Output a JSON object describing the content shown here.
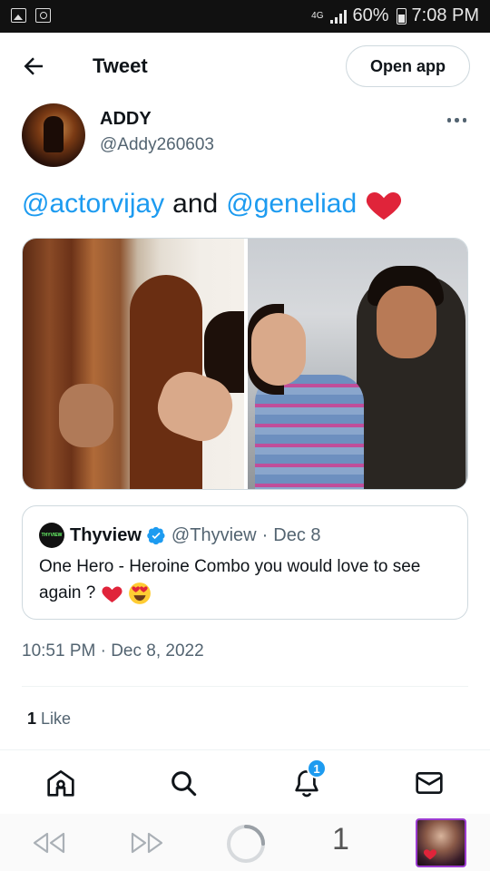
{
  "status_bar": {
    "network": "4G",
    "battery": "60%",
    "time": "7:08 PM"
  },
  "header": {
    "back_icon": "arrow-left-icon",
    "title": "Tweet",
    "open_app_label": "Open app"
  },
  "tweet": {
    "author_name": "ADDY",
    "author_handle": "@Addy260603",
    "text_parts": {
      "mention1": "@actorvijay",
      "connector": "and",
      "mention2": "@geneliad",
      "emoji": "red-heart-icon"
    },
    "media": {
      "photo_count": 2
    },
    "timestamp": "10:51 PM · Dec 8, 2022",
    "likes_count": "1",
    "likes_label": "Like"
  },
  "quoted_tweet": {
    "logo_text": "THYVIEW",
    "name": "Thyview",
    "handle": "@Thyview",
    "dot": "·",
    "date": "Dec 8",
    "text": "One Hero - Heroine Combo you would love to see again ?",
    "emojis": [
      "red-heart-icon",
      "heart-eyes-icon"
    ]
  },
  "tab_bar": {
    "items": [
      "home-icon",
      "search-icon",
      "bell-icon",
      "mail-icon"
    ],
    "notifications_badge": "1"
  },
  "browser_bar": {
    "tab_count": "1"
  },
  "colors": {
    "accent": "#1d9bf0",
    "text": "#0f1419",
    "secondary": "#536471",
    "border": "#cfd9de",
    "heart": "#f91880"
  }
}
